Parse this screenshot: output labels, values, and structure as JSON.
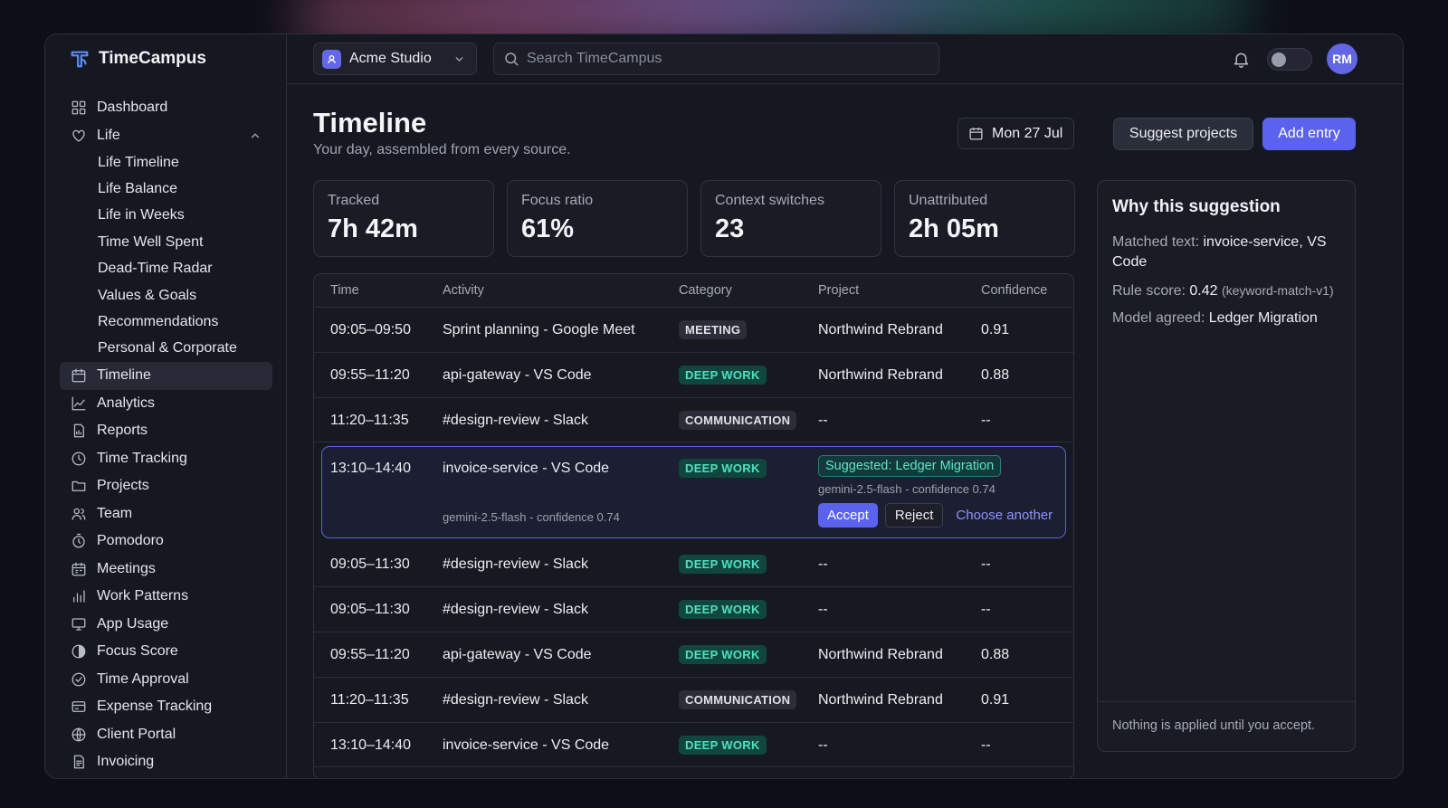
{
  "app": {
    "name": "TimeCampus"
  },
  "sidebar": {
    "items": [
      {
        "label": "Dashboard",
        "icon": "dashboard-icon"
      },
      {
        "label": "Life",
        "icon": "heart-icon",
        "expanded": true
      },
      {
        "label": "Life Timeline",
        "sub": true
      },
      {
        "label": "Life Balance",
        "sub": true
      },
      {
        "label": "Life in Weeks",
        "sub": true
      },
      {
        "label": "Time Well Spent",
        "sub": true
      },
      {
        "label": "Dead-Time Radar",
        "sub": true
      },
      {
        "label": "Values & Goals",
        "sub": true
      },
      {
        "label": "Recommendations",
        "sub": true
      },
      {
        "label": "Personal & Corporate",
        "sub": true
      },
      {
        "label": "Timeline",
        "icon": "calendar-icon",
        "active": true
      },
      {
        "label": "Analytics",
        "icon": "line-chart-icon"
      },
      {
        "label": "Reports",
        "icon": "report-icon"
      },
      {
        "label": "Time Tracking",
        "icon": "clock-icon"
      },
      {
        "label": "Projects",
        "icon": "folder-icon"
      },
      {
        "label": "Team",
        "icon": "users-icon"
      },
      {
        "label": "Pomodoro",
        "icon": "timer-icon"
      },
      {
        "label": "Meetings",
        "icon": "calendar-grid-icon"
      },
      {
        "label": "Work Patterns",
        "icon": "bar-chart-icon"
      },
      {
        "label": "App Usage",
        "icon": "monitor-icon"
      },
      {
        "label": "Focus Score",
        "icon": "half-circle-icon"
      },
      {
        "label": "Time Approval",
        "icon": "check-circle-icon"
      },
      {
        "label": "Expense Tracking",
        "icon": "card-icon"
      },
      {
        "label": "Client Portal",
        "icon": "globe-icon"
      },
      {
        "label": "Invoicing",
        "icon": "invoice-icon"
      }
    ]
  },
  "topbar": {
    "org": "Acme Studio",
    "search_placeholder": "Search TimeCampus",
    "avatar_initials": "RM"
  },
  "page": {
    "title": "Timeline",
    "subtitle": "Your day, assembled from every source.",
    "date": "Mon 27 Jul",
    "suggest_label": "Suggest projects",
    "add_label": "Add entry"
  },
  "stats": [
    {
      "label": "Tracked",
      "value": "7h 42m"
    },
    {
      "label": "Focus ratio",
      "value": "61%"
    },
    {
      "label": "Context switches",
      "value": "23"
    },
    {
      "label": "Unattributed",
      "value": "2h 05m"
    }
  ],
  "table": {
    "headers": [
      "Time",
      "Activity",
      "Category",
      "Project",
      "Confidence"
    ],
    "rows": [
      {
        "time": "09:05–09:50",
        "activity": "Sprint planning - Google Meet",
        "category": "MEETING",
        "project": "Northwind Rebrand",
        "confidence": "0.91"
      },
      {
        "time": "09:55–11:20",
        "activity": "api-gateway - VS Code",
        "category": "DEEP WORK",
        "project": "Northwind Rebrand",
        "confidence": "0.88"
      },
      {
        "time": "11:20–11:35",
        "activity": "#design-review - Slack",
        "category": "COMMUNICATION",
        "project": "--",
        "confidence": "--"
      },
      {
        "time": "13:10–14:40",
        "activity": "invoice-service - VS Code",
        "category": "DEEP WORK",
        "project": "",
        "confidence": ""
      },
      {
        "time": "09:05–11:30",
        "activity": "#design-review - Slack",
        "category": "DEEP WORK",
        "project": "--",
        "confidence": "--"
      },
      {
        "time": "09:05–11:30",
        "activity": "#design-review - Slack",
        "category": "DEEP WORK",
        "project": "--",
        "confidence": "--"
      },
      {
        "time": "09:55–11:20",
        "activity": "api-gateway - VS Code",
        "category": "DEEP WORK",
        "project": "Northwind Rebrand",
        "confidence": "0.88"
      },
      {
        "time": "11:20–11:35",
        "activity": "#design-review - Slack",
        "category": "COMMUNICATION",
        "project": "Northwind Rebrand",
        "confidence": "0.91"
      },
      {
        "time": "13:10–14:40",
        "activity": "invoice-service - VS Code",
        "category": "DEEP WORK",
        "project": "--",
        "confidence": "--"
      }
    ],
    "suggestion": {
      "badge": "Suggested: Ledger Migration",
      "meta": "gemini-2.5-flash - confidence 0.74",
      "activity_meta": "gemini-2.5-flash - confidence 0.74",
      "accept": "Accept",
      "reject": "Reject",
      "choose": "Choose another"
    }
  },
  "panel": {
    "title": "Why this suggestion",
    "matched_label": "Matched text:",
    "matched_value": "invoice-service, VS Code",
    "rule_label": "Rule score:",
    "rule_value": "0.42",
    "rule_note": "(keyword-match-v1)",
    "model_label": "Model agreed:",
    "model_value": "Ledger Migration",
    "footer": "Nothing is applied until you accept."
  },
  "colors": {
    "accent": "#5b63ee",
    "deep_work": "#4ee0c0",
    "background": "#161821"
  }
}
